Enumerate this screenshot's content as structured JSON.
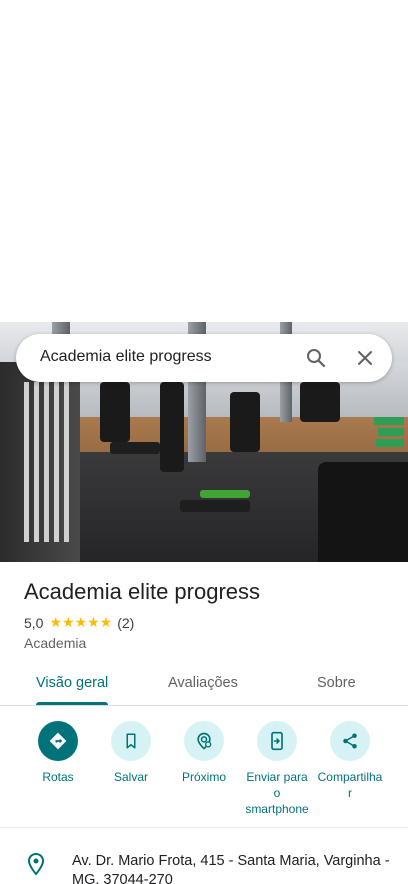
{
  "search": {
    "query": "Academia elite progress"
  },
  "place": {
    "name": "Academia elite progress",
    "rating": "5,0",
    "stars": "★★★★★",
    "review_count": "(2)",
    "category": "Academia"
  },
  "tabs": [
    {
      "label": "Visão geral",
      "active": true
    },
    {
      "label": "Avaliações",
      "active": false
    },
    {
      "label": "Sobre",
      "active": false
    }
  ],
  "actions": [
    {
      "label": "Rotas",
      "icon": "directions-icon"
    },
    {
      "label": "Salvar",
      "icon": "bookmark-icon"
    },
    {
      "label": "Próximo",
      "icon": "nearby-icon"
    },
    {
      "label": "Enviar para o smartphone",
      "label_lines": [
        "Enviar para",
        "o",
        "smartphone"
      ],
      "icon": "send-to-phone-icon"
    },
    {
      "label": "Compartilhar",
      "label_lines": [
        "Compartilha",
        "r"
      ],
      "icon": "share-icon"
    }
  ],
  "address": {
    "text": "Av. Dr. Mario Frota, 415 - Santa Maria, Varginha - MG, 37044-270"
  },
  "colors": {
    "accent": "#00737a",
    "accent_light": "#d7f2f4",
    "star": "#fbbc04"
  }
}
